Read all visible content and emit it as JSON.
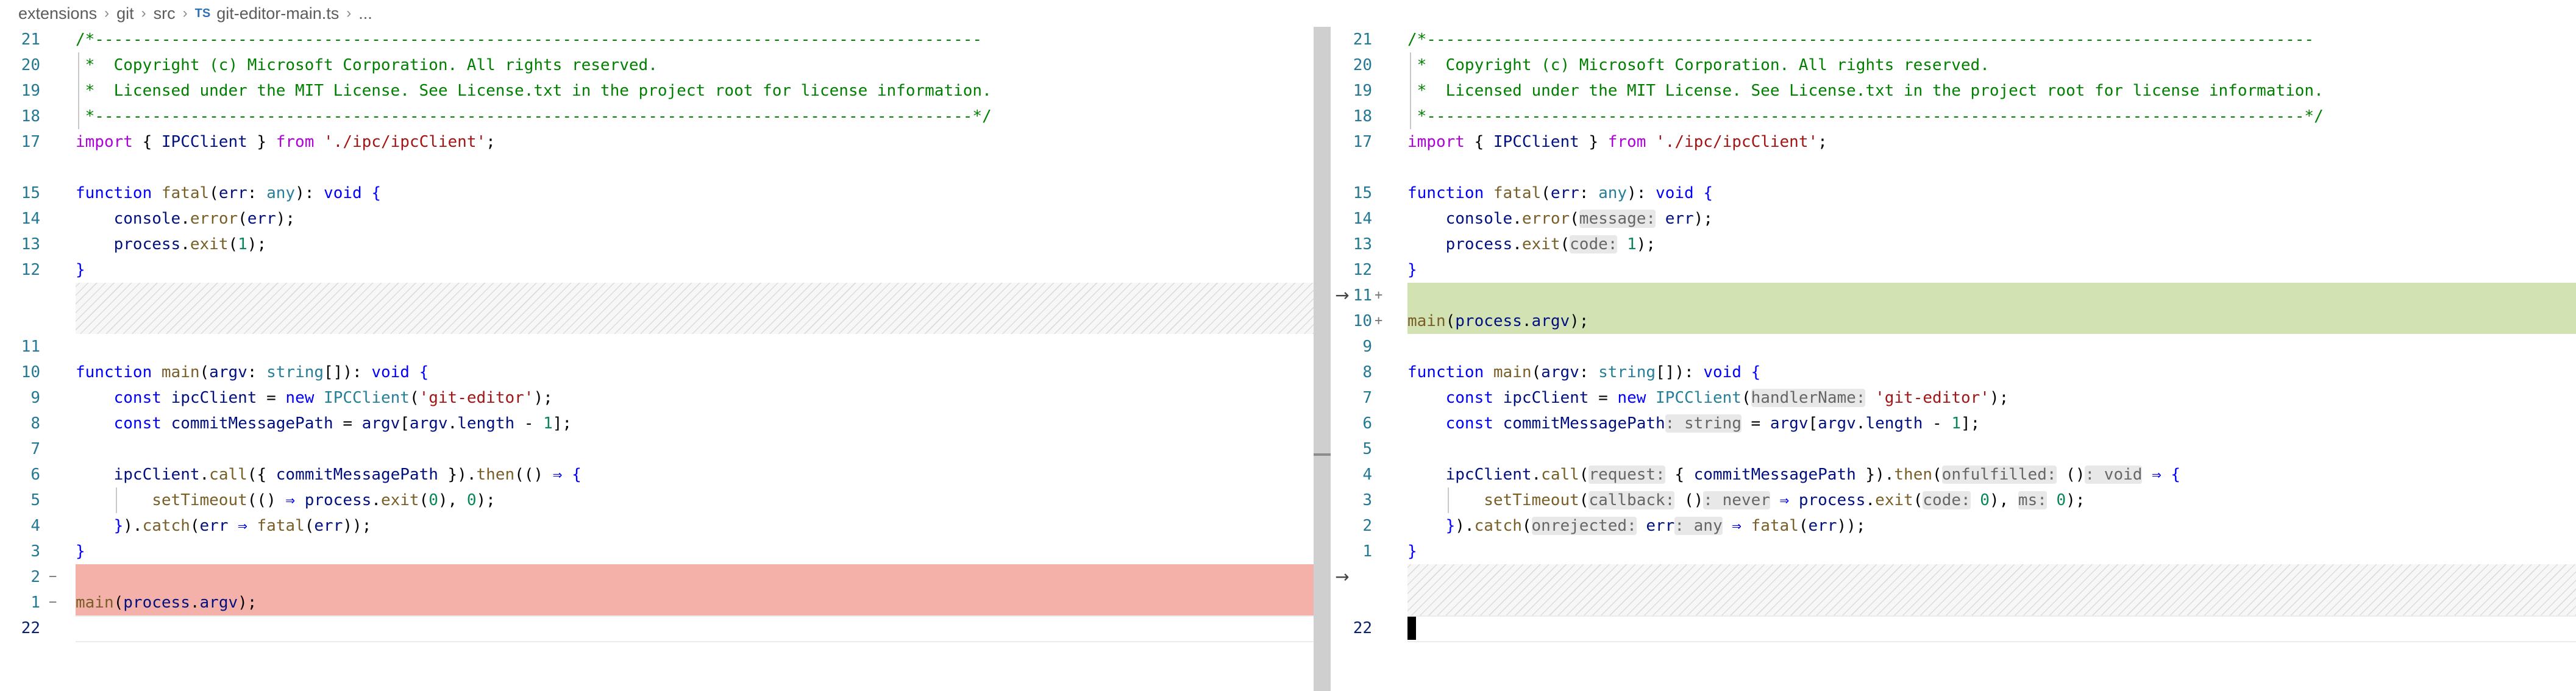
{
  "breadcrumb": {
    "items": [
      "extensions",
      "git",
      "src"
    ],
    "file_badge": "TS",
    "file_name": "git-editor-main.ts",
    "ellipsis": "..."
  },
  "left": {
    "line_numbers": [
      "21",
      "20",
      "19",
      "18",
      "17",
      "",
      "15",
      "14",
      "13",
      "12",
      "",
      "",
      "11",
      "",
      "10",
      "9",
      "8",
      "7",
      "6",
      "5",
      "4",
      "3",
      "2",
      "1",
      "22"
    ],
    "removed_markers": [
      "−",
      "−"
    ]
  },
  "right": {
    "line_numbers": [
      "21",
      "20",
      "19",
      "18",
      "17",
      "",
      "15",
      "14",
      "13",
      "12",
      "11",
      "10",
      "9",
      "",
      "8",
      "7",
      "6",
      "5",
      "4",
      "3",
      "2",
      "1",
      "",
      "",
      "22"
    ],
    "added_markers": [
      "+",
      "+"
    ]
  },
  "code": {
    "comment_top": "/*---------------------------------------------------------------------------------------------",
    "copyright": " *  Copyright (c) Microsoft Corporation. All rights reserved.",
    "license": " *  Licensed under the MIT License. See License.txt in the project root for license information.",
    "comment_bottom": " *--------------------------------------------------------------------------------------------*/",
    "import_kw": "import",
    "import_open": " { ",
    "import_name": "IPCClient",
    "import_close": " } ",
    "from_kw": "from",
    "import_path": "'./ipc/ipcClient'",
    "semicolon": ";",
    "function_kw": "function",
    "fatal_fn": "fatal",
    "err_param": "err",
    "colon": ": ",
    "any_type": "any",
    "void_type": "void",
    "open_brace": "{",
    "close_brace": "}",
    "console": "console",
    "error_fn": "error",
    "process": "process",
    "exit_fn": "exit",
    "one": "1",
    "zero": "0",
    "main_fn": "main",
    "argv": "argv",
    "string_type": "string",
    "const_kw": "const",
    "new_kw": "new",
    "ipcClient_var": "ipcClient",
    "git_editor": "'git-editor'",
    "commitMessagePath": "commitMessagePath",
    "length": "length",
    "call_fn": "call",
    "then_fn": "then",
    "catch_fn": "catch",
    "setTimeout": "setTimeout",
    "arrow": "⇒",
    "never_type": "never"
  },
  "hints": {
    "message": "message:",
    "code": "code:",
    "handlerName": "handlerName:",
    "string_type": ": string",
    "request": "request:",
    "onfulfilled": "onfulfilled:",
    "void_ret": ": void",
    "callback": "callback:",
    "never_ret": ": never",
    "ms": "ms:",
    "onrejected": "onrejected:",
    "any_ret": ": any"
  },
  "colors": {
    "removed": "#f4b1aa",
    "added": "#d3e2b3",
    "keyword": "#0000ff",
    "control_keyword": "#af00db",
    "type": "#267f99",
    "function": "#795e26",
    "variable": "#001080",
    "string": "#a31515",
    "number": "#098658",
    "comment": "#008000"
  },
  "icons": {
    "left_arrow_1": "revert-arrow-icon",
    "left_arrow_2": "revert-arrow-icon"
  }
}
